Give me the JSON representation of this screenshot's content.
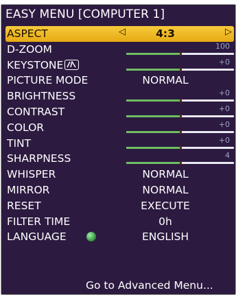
{
  "title": "EASY MENU [COMPUTER 1]",
  "colors": {
    "panel_bg": "#2c1a40",
    "highlight": "#f0bb25",
    "slider_fill": "#6fbf63"
  },
  "aspect": {
    "label": "ASPECT",
    "value": "4:3"
  },
  "dzoom": {
    "label": "D-ZOOM",
    "value": "100",
    "level": 0.5
  },
  "keystone": {
    "label": "KEYSTONE",
    "value": "+0",
    "level": 0.5,
    "icon": "keystone-icon"
  },
  "picture_mode": {
    "label": "PICTURE MODE",
    "value": "NORMAL"
  },
  "brightness": {
    "label": "BRIGHTNESS",
    "value": "+0",
    "level": 0.5
  },
  "contrast": {
    "label": "CONTRAST",
    "value": "+0",
    "level": 0.5
  },
  "color": {
    "label": "COLOR",
    "value": "+0",
    "level": 0.5
  },
  "tint": {
    "label": "TINT",
    "value": "+0",
    "level": 0.5
  },
  "sharpness": {
    "label": "SHARPNESS",
    "value": "4",
    "level": 0.5
  },
  "whisper": {
    "label": "WHISPER",
    "value": "NORMAL"
  },
  "mirror": {
    "label": "MIRROR",
    "value": "NORMAL"
  },
  "reset": {
    "label": "RESET",
    "value": "EXECUTE"
  },
  "filter_time": {
    "label": "FILTER TIME",
    "value": "0h"
  },
  "language": {
    "label": "LANGUAGE",
    "value": "ENGLISH",
    "icon": "globe-icon"
  },
  "advanced": {
    "label": "Go to Advanced Menu..."
  }
}
